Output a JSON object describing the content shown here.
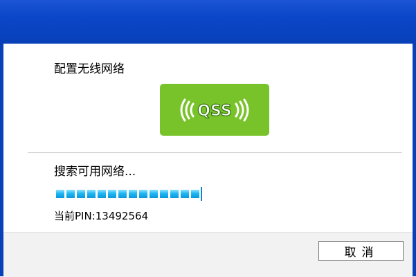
{
  "dialog": {
    "heading": "配置无线网络",
    "logo_text": "QSS",
    "logo_color": "#79c32a",
    "status_text": "搜索可用网络...",
    "progress_fraction": 0.92,
    "pin_label": "当前",
    "pin_value": "PIN:13492564",
    "cancel_label": "取消"
  }
}
